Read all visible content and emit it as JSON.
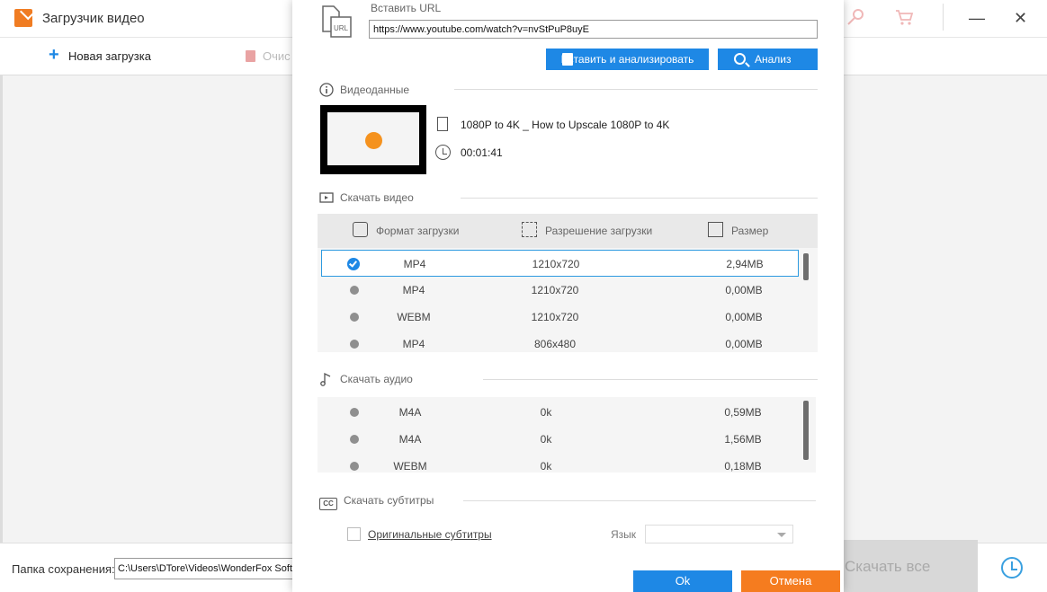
{
  "app": {
    "title": "Загрузчик видео",
    "new_download_label": "Новая загрузка",
    "clear_label": "Очис",
    "save_folder_label": "Папка сохранения:",
    "save_folder_path": "C:\\Users\\DTore\\Videos\\WonderFox Soft\\",
    "download_all_label": "Скачать все"
  },
  "dialog": {
    "url_label": "Вставить URL",
    "url_value": "https://www.youtube.com/watch?v=nvStPuP8uyE",
    "paste_analyze_label": "Вставить и анализировать",
    "analyze_label": "Анализ",
    "video_info": {
      "section_label": "Видеоданные",
      "title": "1080P to 4K _ How to Upscale 1080P to 4K",
      "duration": "00:01:41"
    },
    "video_download": {
      "section_label": "Скачать видео",
      "headers": {
        "format": "Формат загрузки",
        "resolution": "Разрешение загрузки",
        "size": "Размер"
      },
      "rows": [
        {
          "format": "MP4",
          "resolution": "1210x720",
          "size": "2,94MB",
          "selected": true
        },
        {
          "format": "MP4",
          "resolution": "1210x720",
          "size": "0,00MB",
          "selected": false
        },
        {
          "format": "WEBM",
          "resolution": "1210x720",
          "size": "0,00MB",
          "selected": false
        },
        {
          "format": "MP4",
          "resolution": "806x480",
          "size": "0,00MB",
          "selected": false
        }
      ]
    },
    "audio_download": {
      "section_label": "Скачать аудио",
      "rows": [
        {
          "format": "M4A",
          "bitrate": "0k",
          "size": "0,59MB"
        },
        {
          "format": "M4A",
          "bitrate": "0k",
          "size": "1,56MB"
        },
        {
          "format": "WEBM",
          "bitrate": "0k",
          "size": "0,18MB"
        }
      ]
    },
    "subtitles": {
      "section_label": "Скачать субтитры",
      "original_label": "Оригинальные субтитры",
      "language_label": "Язык",
      "language_value": ""
    },
    "ok_label": "Ok",
    "cancel_label": "Отмена"
  }
}
